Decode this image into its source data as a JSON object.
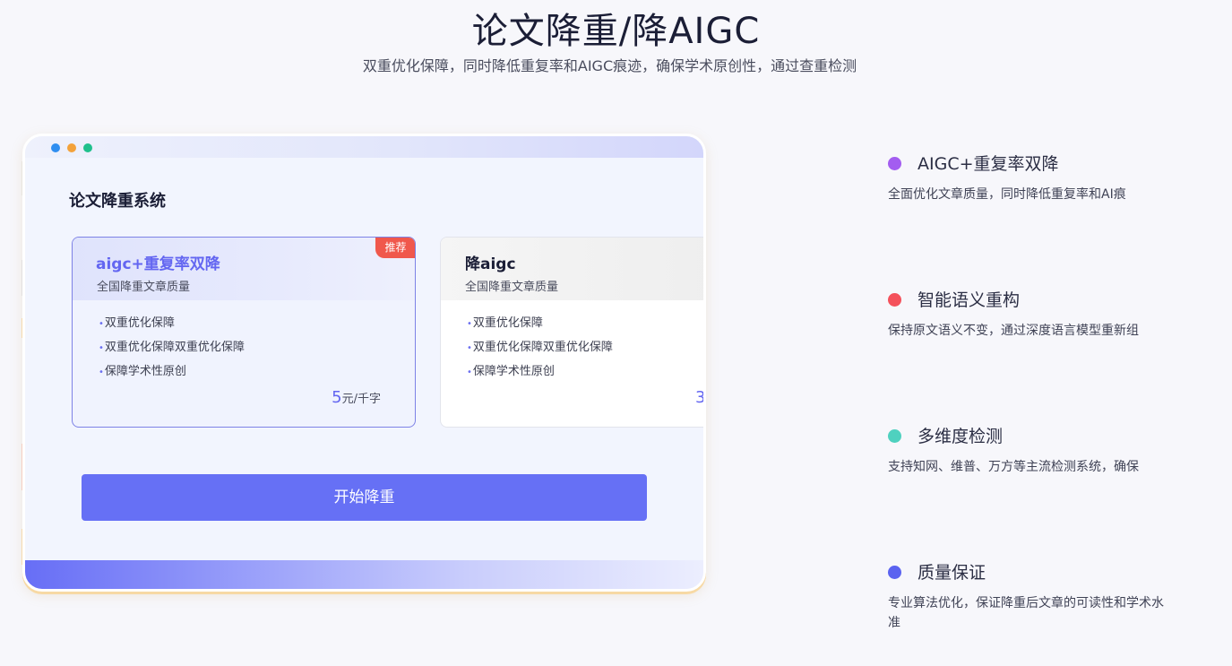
{
  "header": {
    "title": "论文降重/降AIGC",
    "subtitle": "双重优化保障，同时降低重复率和AIGC痕迹，确保学术原创性，通过查重检测"
  },
  "window": {
    "dots": [
      {
        "color": "#2f8ef0"
      },
      {
        "color": "#f3a23a"
      },
      {
        "color": "#1fc08c"
      }
    ],
    "heading": "论文降重系统",
    "plans": [
      {
        "name": "aigc+重复率双降",
        "desc": "全国降重文章质量",
        "badge": "推荐",
        "features": [
          "双重优化保障",
          "双重优化保障双重优化保障",
          "保障学术性原创"
        ],
        "price": "5",
        "unit": "元/千字",
        "selected": true
      },
      {
        "name": "降aigc",
        "desc": "全国降重文章质量",
        "features": [
          "双重优化保障",
          "双重优化保障双重优化保障",
          "保障学术性原创"
        ],
        "price": "3",
        "selected": false
      }
    ],
    "start_button": "开始降重"
  },
  "features": [
    {
      "title": "AIGC+重复率双降",
      "desc": "全面优化文章质量，同时降低重复率和AI痕",
      "color": "#a35df0"
    },
    {
      "title": "智能语义重构",
      "desc": "保持原文语义不变，通过深度语言模型重新组",
      "color": "#f4515b"
    },
    {
      "title": "多维度检测",
      "desc": "支持知网、维普、万方等主流检测系统，确保",
      "color": "#4fd1bf"
    },
    {
      "title": "质量保证",
      "desc": "专业算法优化，保证降重后文章的可读性和学术水准",
      "color": "#5b63f0"
    }
  ],
  "bullet_char": "•"
}
